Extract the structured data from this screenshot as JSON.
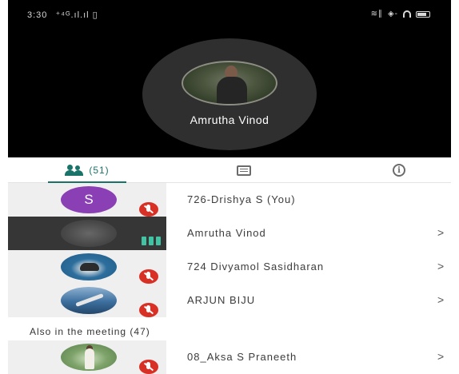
{
  "status_bar": {
    "time": "3:30",
    "left_icons": "⁺ 𝟒𝙶 .ıl .ıl ▯▯",
    "right_text": "≋∥ ◈"
  },
  "speaker": {
    "name": "Amrutha Vinod",
    "shirt_text": "BLACK SHIRT"
  },
  "tabs": {
    "people_count": "(51)",
    "active": "people"
  },
  "participants": [
    {
      "name": "726-Drishya S (You)",
      "avatar": "letter",
      "avatar_letter": "S",
      "avatar_color": "#8b3fb4",
      "state": "muted",
      "chevron": ""
    },
    {
      "name": "Amrutha Vinod",
      "avatar": "photo",
      "state": "talking",
      "chevron": ">"
    },
    {
      "name": "724 Divyamol Sasidharan",
      "avatar": "photo",
      "state": "muted",
      "chevron": ">"
    },
    {
      "name": "ARJUN BIJU",
      "avatar": "photo",
      "state": "muted",
      "chevron": ">"
    }
  ],
  "also_section": {
    "label": "Also in the meeting (47)",
    "participants": [
      {
        "name": "08_Aksa S Praneeth",
        "avatar": "photo",
        "state": "muted",
        "chevron": ">"
      }
    ]
  },
  "colors": {
    "accent": "#1a7369",
    "mute": "#d93025",
    "talking": "#41c4a3",
    "stage_bg": "#000000"
  }
}
